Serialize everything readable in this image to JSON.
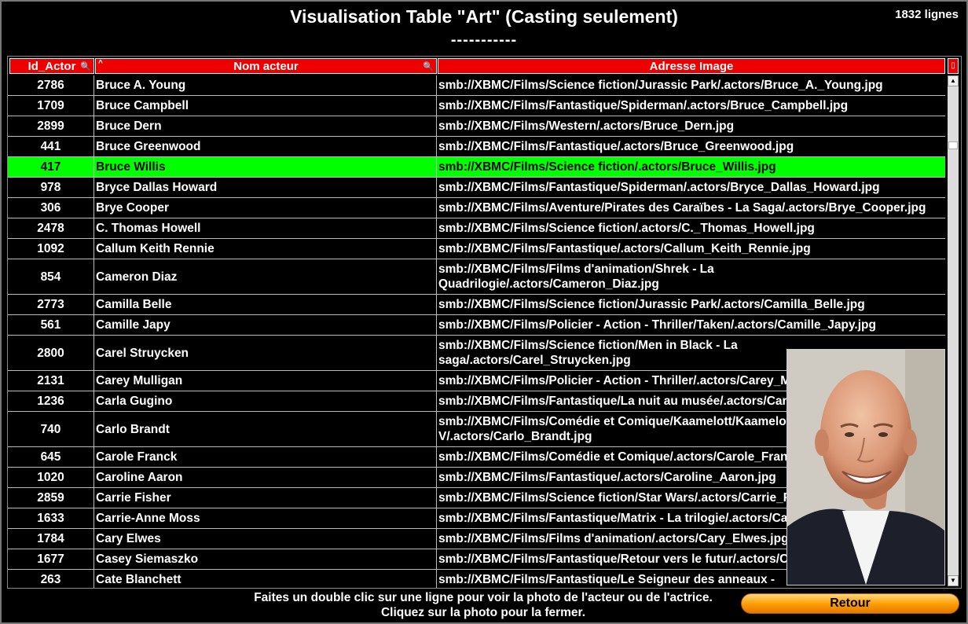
{
  "header": {
    "title": "Visualisation Table \"Art\" (Casting seulement)",
    "separator": "-----------",
    "row_count": "1832 lignes"
  },
  "table": {
    "columns": [
      "Id_Actor",
      "Nom acteur",
      "Adresse Image"
    ],
    "selected_row": 4,
    "rows": [
      [
        "2786",
        "Bruce A. Young",
        "smb://XBMC/Films/Science fiction/Jurassic Park/.actors/Bruce_A._Young.jpg"
      ],
      [
        "1709",
        "Bruce Campbell",
        "smb://XBMC/Films/Fantastique/Spiderman/.actors/Bruce_Campbell.jpg"
      ],
      [
        "2899",
        "Bruce Dern",
        "smb://XBMC/Films/Western/.actors/Bruce_Dern.jpg"
      ],
      [
        "441",
        "Bruce Greenwood",
        "smb://XBMC/Films/Fantastique/.actors/Bruce_Greenwood.jpg"
      ],
      [
        "417",
        "Bruce Willis",
        "smb://XBMC/Films/Science fiction/.actors/Bruce_Willis.jpg"
      ],
      [
        "978",
        "Bryce Dallas Howard",
        "smb://XBMC/Films/Fantastique/Spiderman/.actors/Bryce_Dallas_Howard.jpg"
      ],
      [
        "306",
        "Brye Cooper",
        "smb://XBMC/Films/Aventure/Pirates des Caraïbes - La Saga/.actors/Brye_Cooper.jpg"
      ],
      [
        "2478",
        "C. Thomas Howell",
        "smb://XBMC/Films/Science fiction/.actors/C._Thomas_Howell.jpg"
      ],
      [
        "1092",
        "Callum Keith Rennie",
        "smb://XBMC/Films/Fantastique/.actors/Callum_Keith_Rennie.jpg"
      ],
      [
        "854",
        "Cameron Diaz",
        "smb://XBMC/Films/Films d'animation/Shrek - La\nQuadrilogie/.actors/Cameron_Diaz.jpg"
      ],
      [
        "2773",
        "Camilla Belle",
        "smb://XBMC/Films/Science fiction/Jurassic Park/.actors/Camilla_Belle.jpg"
      ],
      [
        "561",
        "Camille Japy",
        "smb://XBMC/Films/Policier - Action - Thriller/Taken/.actors/Camille_Japy.jpg"
      ],
      [
        "2800",
        "Carel Struycken",
        "smb://XBMC/Films/Science fiction/Men in Black - La\nsaga/.actors/Carel_Struycken.jpg"
      ],
      [
        "2131",
        "Carey Mulligan",
        "smb://XBMC/Films/Policier - Action - Thriller/.actors/Carey_Mulligan.jpg"
      ],
      [
        "1236",
        "Carla Gugino",
        "smb://XBMC/Films/Fantastique/La nuit au musée/.actors/Carla_Gugino.jpg"
      ],
      [
        "740",
        "Carlo Brandt",
        "smb://XBMC/Films/Comédie et Comique/Kaamelott/Kaamelott\nV/.actors/Carlo_Brandt.jpg"
      ],
      [
        "645",
        "Carole Franck",
        "smb://XBMC/Films/Comédie et Comique/.actors/Carole_Franck.jpg"
      ],
      [
        "1020",
        "Caroline Aaron",
        "smb://XBMC/Films/Fantastique/.actors/Caroline_Aaron.jpg"
      ],
      [
        "2859",
        "Carrie Fisher",
        "smb://XBMC/Films/Science fiction/Star Wars/.actors/Carrie_Fisher.jpg"
      ],
      [
        "1633",
        "Carrie-Anne Moss",
        "smb://XBMC/Films/Fantastique/Matrix - La trilogie/.actors/Carrie-Anne_Moss.jpg"
      ],
      [
        "1784",
        "Cary Elwes",
        "smb://XBMC/Films/Films d'animation/.actors/Cary_Elwes.jpg"
      ],
      [
        "1677",
        "Casey Siemaszko",
        "smb://XBMC/Films/Fantastique/Retour vers le futur/.actors/Casey_Siemaszko.jpg"
      ],
      [
        "263",
        "Cate Blanchett",
        "smb://XBMC/Films/Fantastique/Le Seigneur des anneaux -"
      ]
    ]
  },
  "photo": {
    "icon": "actor-portrait"
  },
  "footer": {
    "help_line1": "Faites un double clic sur une ligne pour voir la photo de l'acteur ou de l'actrice.",
    "help_line2": "Cliquez sur la photo pour la fermer.",
    "button_label": "Retour"
  },
  "colors": {
    "header": "#ee0000",
    "selected_row": "#00ff00",
    "button": "#ff9b00"
  }
}
